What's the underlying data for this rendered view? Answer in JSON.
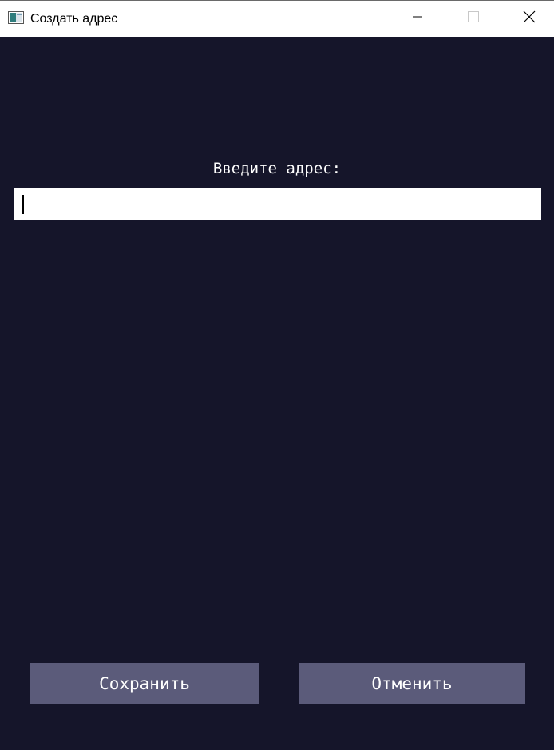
{
  "window": {
    "title": "Создать адрес",
    "icon": "app-window-icon",
    "controls": {
      "minimize_icon": "minimize-icon",
      "maximize_icon": "maximize-icon",
      "close_icon": "close-icon"
    }
  },
  "form": {
    "prompt": "Введите адрес:",
    "address_value": "",
    "address_placeholder": ""
  },
  "actions": {
    "save_label": "Сохранить",
    "cancel_label": "Отменить"
  },
  "colors": {
    "background": "#15152a",
    "button": "#5b5b7a",
    "titlebar": "#ffffff",
    "text_light": "#ffffff"
  }
}
